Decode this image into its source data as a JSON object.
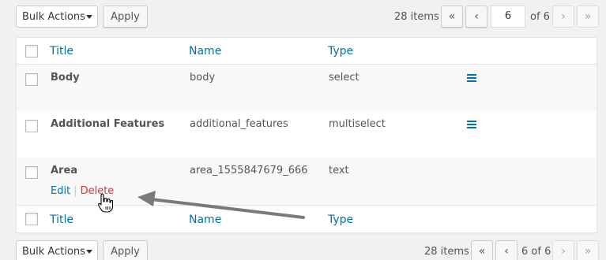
{
  "top_nav": {
    "bulk_actions": "Bulk Actions",
    "apply": "Apply",
    "items": "28 items",
    "first": "«",
    "prev": "‹",
    "current_page": "6",
    "of_total": "of 6",
    "next": "›",
    "last": "»"
  },
  "bottom_nav": {
    "bulk_actions": "Bulk Actions",
    "apply": "Apply",
    "items": "28 items",
    "first": "«",
    "prev": "‹",
    "page_display": "6 of 6",
    "next": "›",
    "last": "»"
  },
  "table": {
    "headers": {
      "title": "Title",
      "name": "Name",
      "type": "Type"
    },
    "rows": [
      {
        "title": "Body",
        "name": "body",
        "type": "select"
      },
      {
        "title": "Additional Features",
        "name": "additional_features",
        "type": "multiselect"
      },
      {
        "title": "Area",
        "name": "area_1555847679_666",
        "type": "text"
      }
    ],
    "row_actions": {
      "edit": "Edit",
      "separator": "|",
      "delete": "Delete"
    }
  },
  "colors": {
    "link": "#0073aa",
    "delete": "#dc3232",
    "background": "#f1f1f1",
    "annotation_arrow": "#7a7a7a"
  },
  "icons": {
    "drag": "hamburger-icon",
    "cursor": "hand-pointer-icon",
    "arrow": "annotation-arrow"
  }
}
